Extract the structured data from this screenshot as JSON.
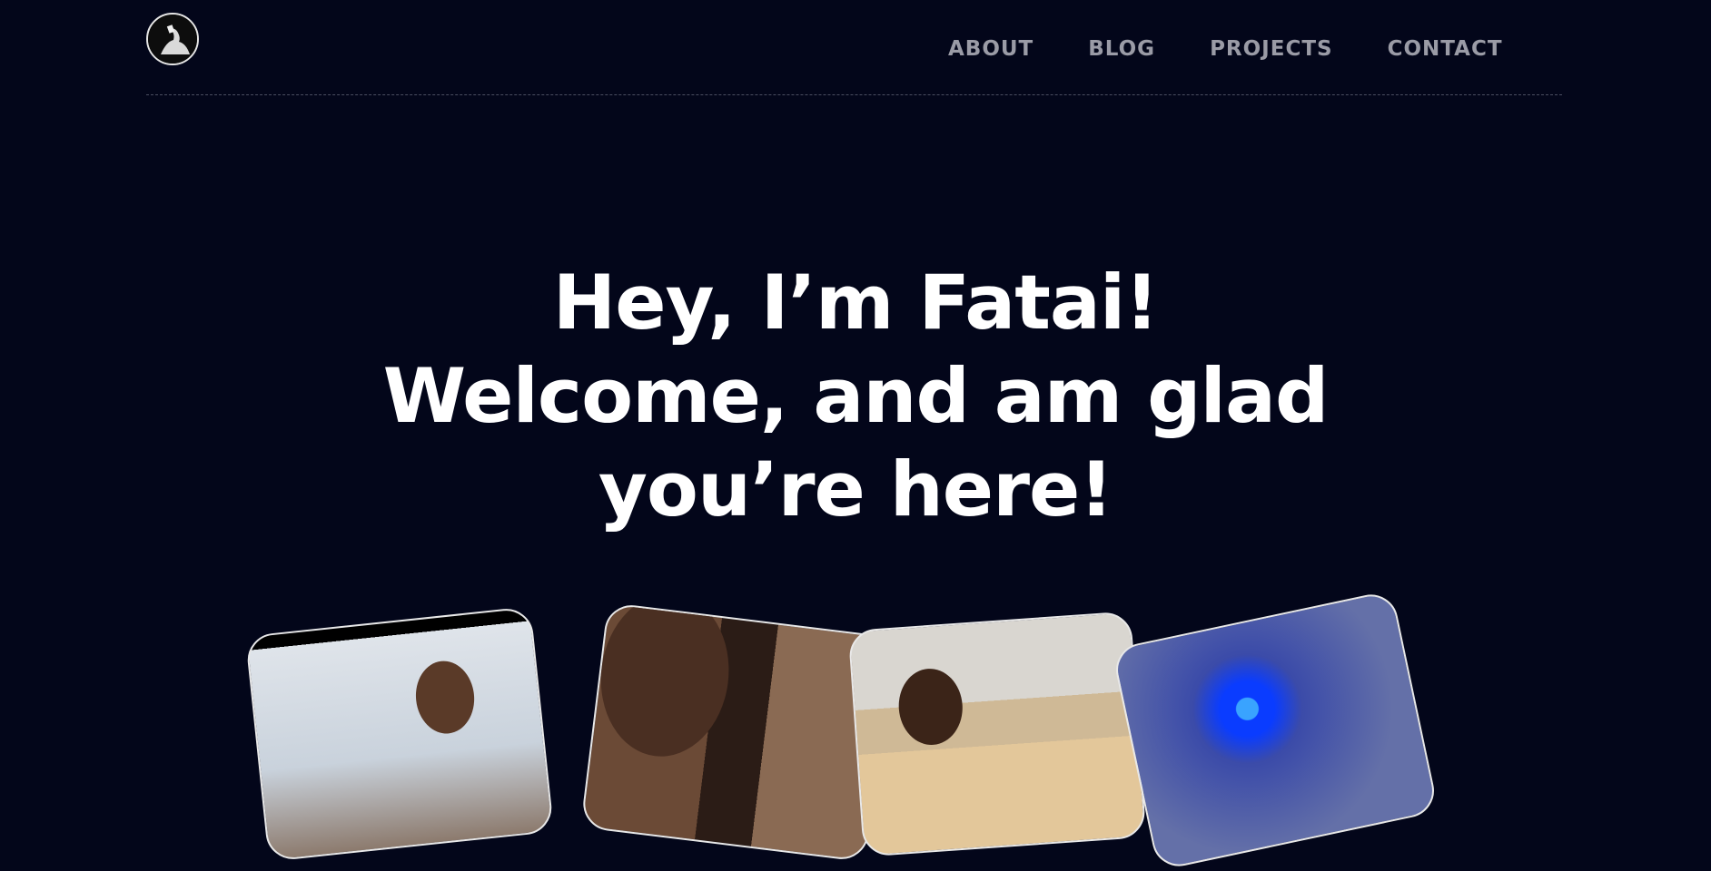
{
  "nav": {
    "items": [
      {
        "label": "ABOUT"
      },
      {
        "label": "BLOG"
      },
      {
        "label": "PROJECTS"
      },
      {
        "label": "CONTACT"
      }
    ]
  },
  "hero": {
    "line1": "Hey, I’m Fatai!",
    "line2": "Welcome, and am glad",
    "line3": "you’re here!"
  },
  "colors": {
    "background": "#03061a",
    "nav_text": "#9a9ba6",
    "heading_text": "#ffffff",
    "divider": "#4a4e60"
  },
  "icons": {
    "logo": "avatar-logo-icon"
  }
}
